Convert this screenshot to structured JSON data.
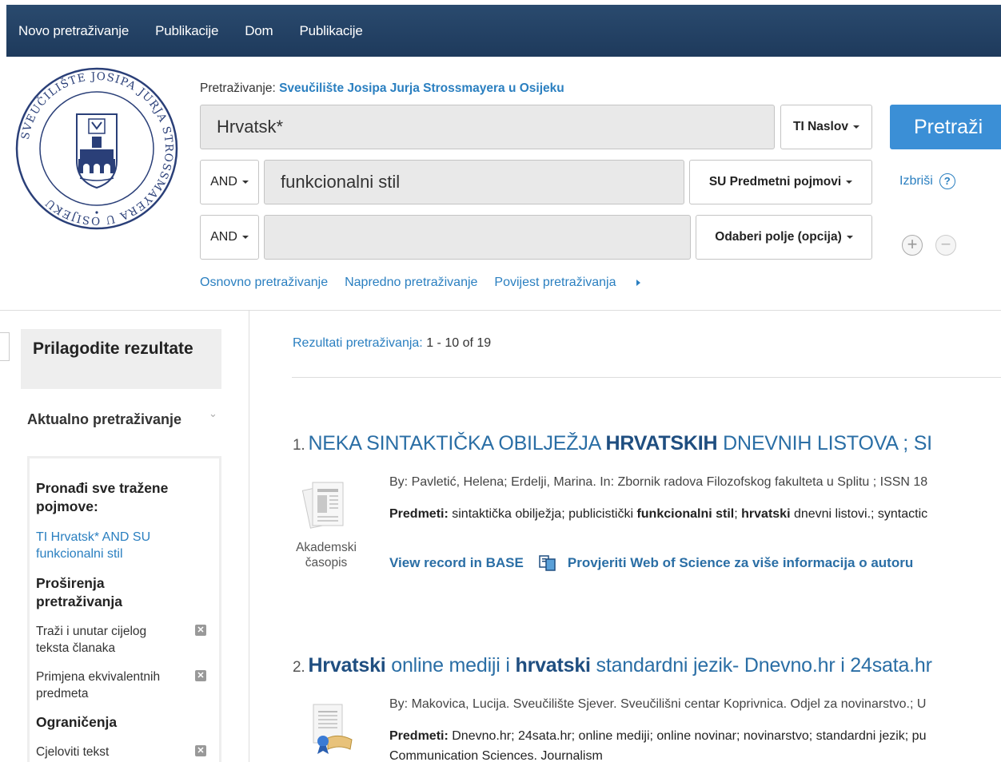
{
  "nav": {
    "new_search": "Novo pretraživanje",
    "publications": "Publikacije",
    "home": "Dom",
    "publications2": "Publikacije"
  },
  "logo": {
    "text": "SVEUČILIŠTE JOSIPA JURJA STROSSMAYERA U OSIJEKU"
  },
  "search": {
    "searching_label": "Pretraživanje:",
    "searching_source": "Sveučilište Josipa Jurja Strossmayera u Osijeku",
    "row1_value": "Hrvatsk*",
    "row1_field": "TI Naslov",
    "row2_bool": "AND",
    "row2_value": "funkcionalni stil",
    "row2_field": "SU Predmetni pojmovi",
    "row3_bool": "AND",
    "row3_value": "",
    "row3_field": "Odaberi polje (opcija)",
    "search_button": "Pretraži",
    "clear": "Izbriši",
    "help": "?",
    "basic": "Osnovno pretraživanje",
    "advanced": "Napredno pretraživanje",
    "history": "Povijest pretraživanja"
  },
  "sidebar": {
    "refine_title": "Prilagodite rezultate",
    "current_search": "Aktualno pretraživanje",
    "find_all_title": "Pronađi sve tražene pojmove:",
    "find_all_query": "TI Hrvatsk* AND SU funkcionalni stil",
    "expanders_title": "Proširenja pretraživanja",
    "expander1": "Traži i unutar cijelog teksta članaka",
    "expander2": "Primjena ekvivalentnih predmeta",
    "limiters_title": "Ograničenja",
    "limiter1": "Cjeloviti tekst"
  },
  "results": {
    "count_label": "Rezultati pretraživanja:",
    "count_value": "1 - 10 of 19",
    "items": [
      {
        "num": "1.",
        "title_pre": "NEKA SINTAKTIČKA OBILJEŽJA ",
        "title_bold": "HRVATSKIH",
        "title_post": " DNEVNIH LISTOVA ; SI",
        "meta": "By: Pavletić, Helena; Erdelji, Marina. In: Zbornik radova Filozofskog fakulteta u Splitu ; ISSN 18",
        "subj_label": "Predmeti:",
        "subj_1": " sintaktička obilježja; publicistički ",
        "subj_b1": "funkcionalni stil",
        "subj_2": "; ",
        "subj_b2": "hrvatski",
        "subj_3": " dnevni listovi.; syntactic",
        "type": "Akademski časopis",
        "link1": "View record in BASE",
        "link2": "Provjeriti Web of Science za više informacija o autoru"
      },
      {
        "num": "2.",
        "title_b1": "Hrvatski",
        "title_1": " online mediji i ",
        "title_b2": "hrvatski",
        "title_2": " standardni jezik- Dnevno.hr i 24sata.hr",
        "meta": "By: Makovica, Lucija. Sveučilište Sjever. Sveučilišni centar Koprivnica. Odjel za novinarstvo.; U",
        "subj_label": "Predmeti:",
        "subj_1": " Dnevno.hr; 24sata.hr; online mediji; online novinar; novinarstvo; standardni jezik; pu",
        "subj_line2": "Communication Sciences. Journalism"
      }
    ]
  },
  "colors": {
    "nav_bg": "#1e3a5c",
    "link": "#2a7fc0",
    "button": "#3b8fd6"
  }
}
